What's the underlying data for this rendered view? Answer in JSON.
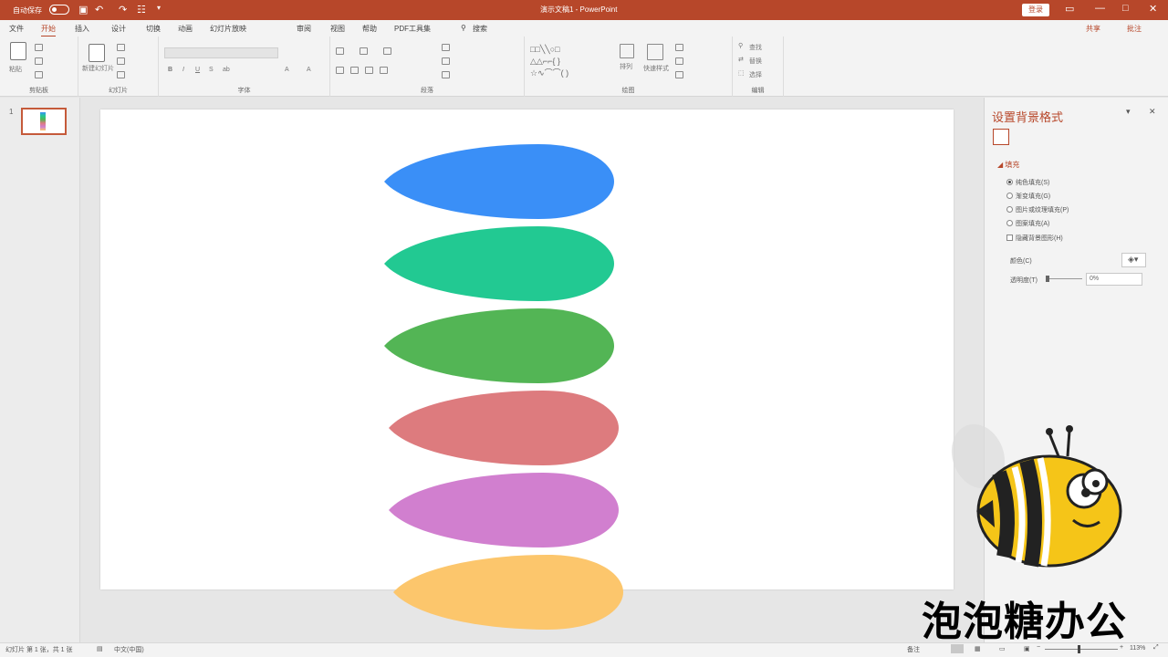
{
  "titlebar": {
    "autosave": "自动保存",
    "doc_title": "演示文稿1 - PowerPoint",
    "signin": "登录",
    "icons": [
      "save-icon",
      "undo-icon",
      "redo-icon",
      "customize-icon"
    ]
  },
  "menu": {
    "tabs": [
      "文件",
      "开始",
      "插入",
      "设计",
      "切换",
      "动画",
      "幻灯片放映",
      "审阅",
      "视图",
      "帮助",
      "PDF工具集",
      "搜索"
    ],
    "active_index": 1,
    "share": "共享",
    "comments": "批注"
  },
  "ribbon": {
    "groups": [
      "剪贴板",
      "幻灯片",
      "字体",
      "段落",
      "绘图",
      "编辑"
    ],
    "paste": "粘贴",
    "new_slide": "新建幻灯片",
    "arrange": "排列",
    "quick_styles": "快速样式",
    "find": "查找",
    "replace": "替换",
    "select": "选择"
  },
  "thumbnails": {
    "count": "1"
  },
  "slide": {
    "shapes": [
      {
        "name": "blue",
        "color": "#3a8ff7"
      },
      {
        "name": "teal",
        "color": "#22c992"
      },
      {
        "name": "green",
        "color": "#53b555"
      },
      {
        "name": "red",
        "color": "#dd7b7e"
      },
      {
        "name": "purple",
        "color": "#d17fcf"
      },
      {
        "name": "orange",
        "color": "#fcc66c"
      }
    ]
  },
  "format_pane": {
    "title": "设置背景格式",
    "section": "填充",
    "options": [
      "纯色填充(S)",
      "渐变填充(G)",
      "图片或纹理填充(P)",
      "图案填充(A)"
    ],
    "hide_bg": "隐藏背景图形(H)",
    "color_label": "颜色(C)",
    "transparency_label": "透明度(T)",
    "transparency_value": "0%"
  },
  "statusbar": {
    "slide_info": "幻灯片 第 1 张，共 1 张",
    "language": "中文(中国)",
    "notes": "备注",
    "zoom": "113%"
  },
  "watermark": {
    "text": "泡泡糖办公"
  }
}
